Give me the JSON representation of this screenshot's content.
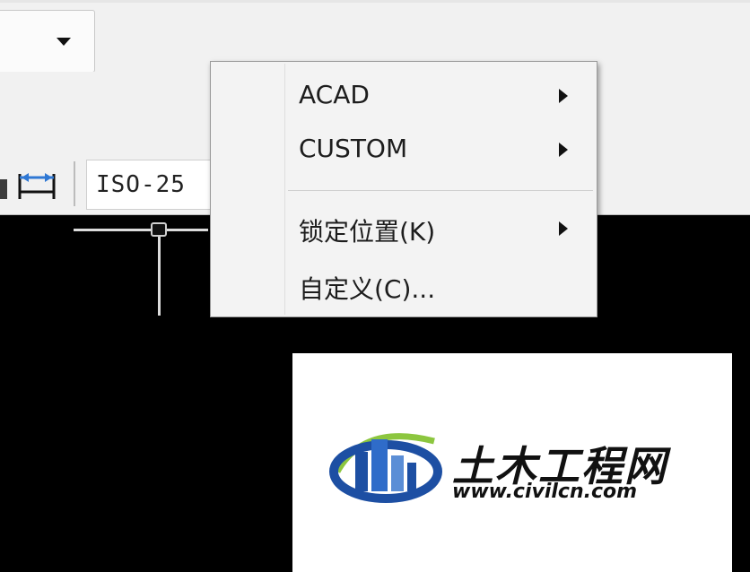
{
  "toolbar": {
    "dim_style_value": "ISO-25"
  },
  "context_menu": {
    "items": [
      {
        "label": "ACAD",
        "has_submenu": true
      },
      {
        "label": "CUSTOM",
        "has_submenu": true
      },
      {
        "label": "锁定位置(K)",
        "has_submenu": true
      },
      {
        "label": "自定义(C)...",
        "has_submenu": false
      }
    ]
  },
  "watermark": {
    "name_cn": "土木工程网",
    "url": "www.civilcn.com",
    "colors": {
      "blue": "#1d4fa3",
      "green": "#8cc63f"
    }
  },
  "icons": [
    "chevron-down-icon",
    "dimension-icon",
    "submenu-arrow-icon"
  ]
}
